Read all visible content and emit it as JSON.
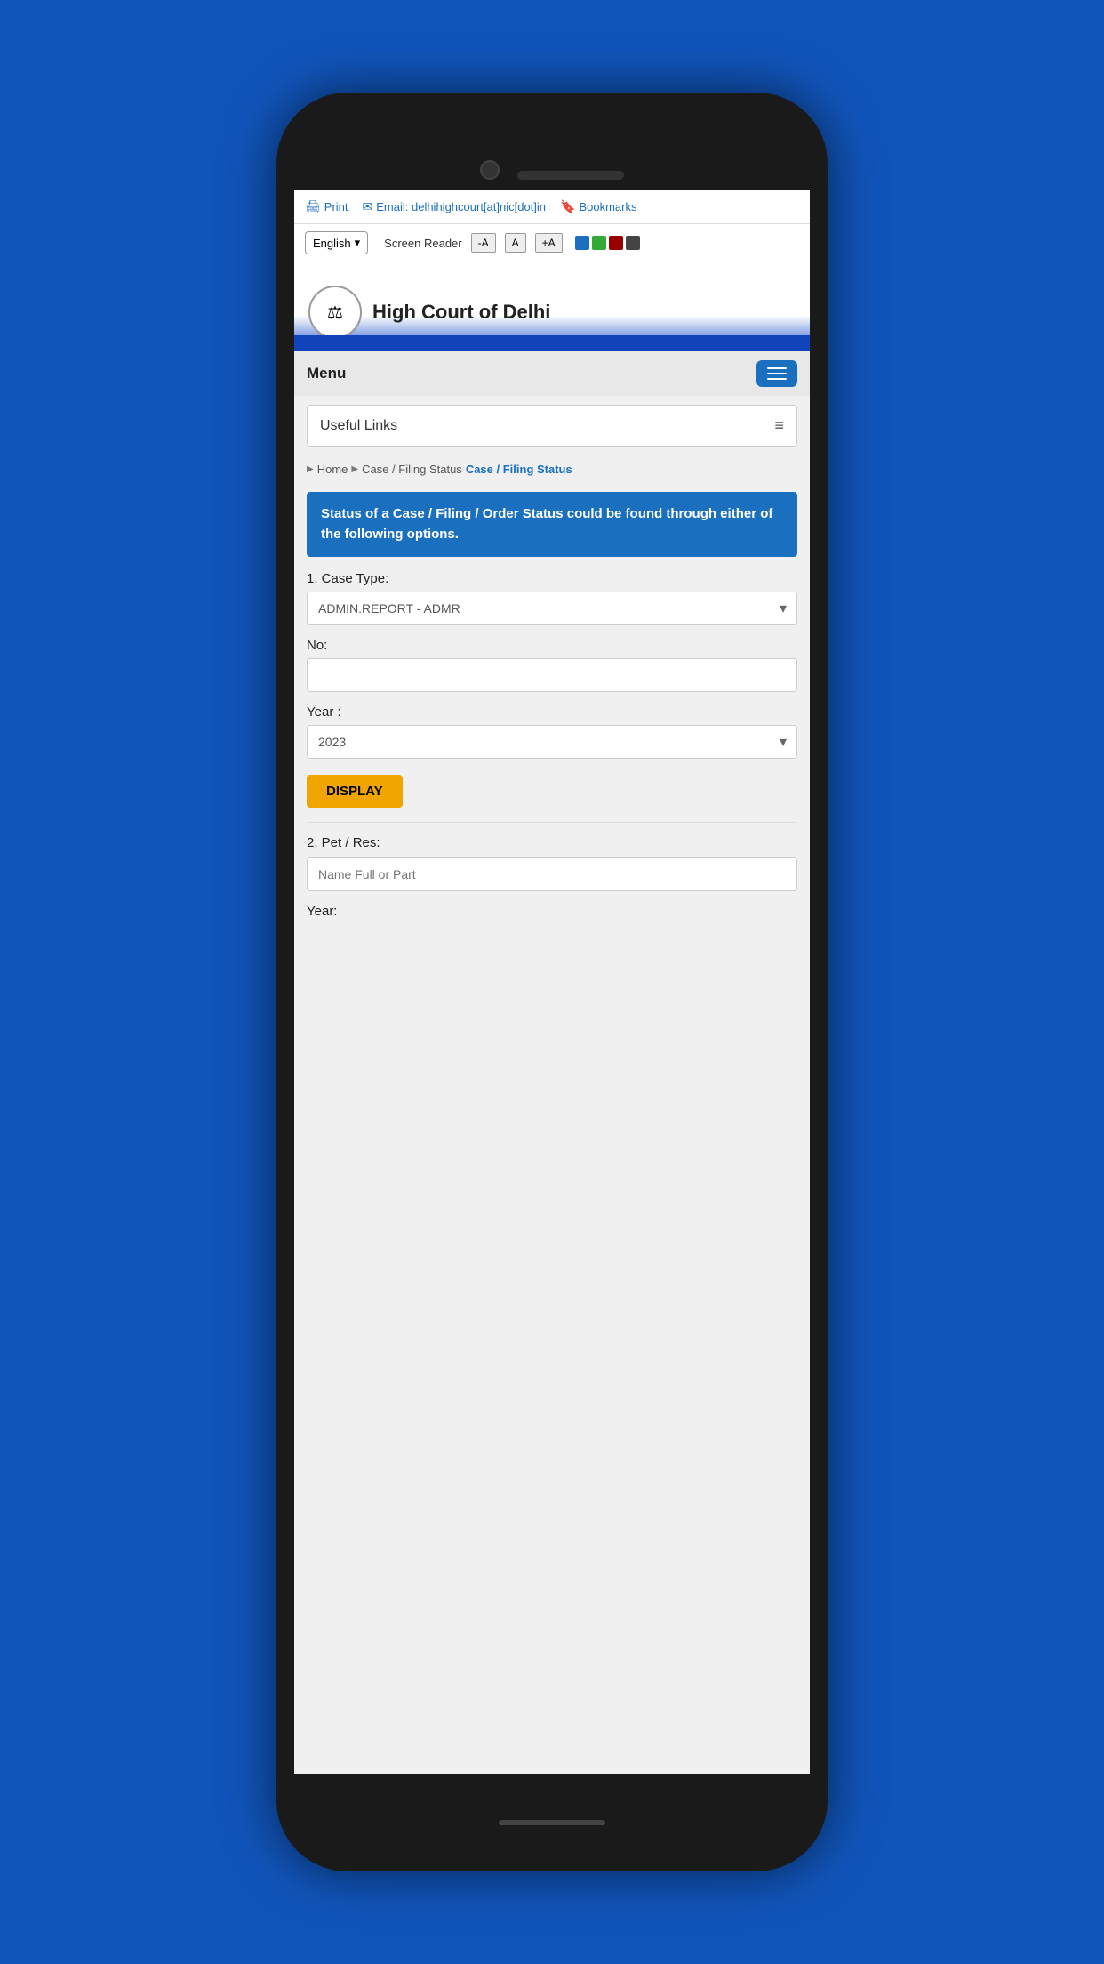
{
  "background": {
    "color": "#1155BB"
  },
  "browser_toolbar": {
    "print_label": "Print",
    "email_label": "Email: delhihighcourt[at]nic[dot]in",
    "bookmarks_label": "Bookmarks"
  },
  "controls_bar": {
    "language": "English",
    "screen_reader_label": "Screen Reader",
    "font_decrease": "-A",
    "font_normal": "A",
    "font_increase": "+A",
    "swatches": [
      "#1a6fbf",
      "#33aa33",
      "#990000",
      "#444444"
    ]
  },
  "header": {
    "emblem_symbol": "⚖",
    "site_title": "High Court of Delhi"
  },
  "nav": {
    "menu_label": "Menu"
  },
  "useful_links": {
    "label": "Useful Links"
  },
  "breadcrumb": {
    "home": "Home",
    "parent": "Case / Filing Status",
    "current": "Case / Filing Status"
  },
  "info_box": {
    "text": "Status of a Case / Filing / Order Status could be found through either of the following options."
  },
  "form": {
    "section1_label": "1. Case Type:",
    "case_type_default": "ADMIN.REPORT - ADMR",
    "no_label": "No:",
    "no_placeholder": "",
    "year_label": "Year :",
    "year_default": "2023",
    "display_button": "DISPLAY",
    "section2_label": "2. Pet / Res:",
    "name_placeholder": "Name Full or Part",
    "year2_label": "Year:"
  }
}
